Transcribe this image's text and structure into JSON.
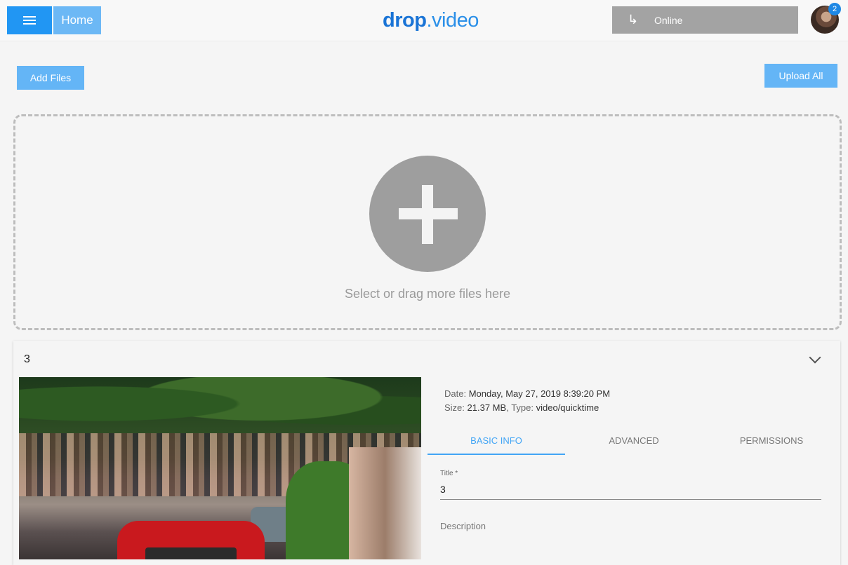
{
  "header": {
    "home_label": "Home",
    "logo_part1": "drop",
    "logo_part2": ".video",
    "status_label": "Online",
    "notification_count": "2"
  },
  "actions": {
    "add_files_label": "Add Files",
    "upload_all_label": "Upload All"
  },
  "dropzone": {
    "prompt": "Select or drag more files here"
  },
  "file": {
    "title": "3",
    "date_label": "Date:",
    "date_value": "Monday, May 27, 2019 8:39:20 PM",
    "size_label": "Size:",
    "size_value": "21.37 MB",
    "type_label": "Type:",
    "type_value": "video/quicktime",
    "tabs": [
      {
        "label": "BASIC INFO",
        "active": true
      },
      {
        "label": "ADVANCED",
        "active": false
      },
      {
        "label": "PERMISSIONS",
        "active": false
      }
    ],
    "form": {
      "title_label": "Title *",
      "title_value": "3",
      "description_label": "Description"
    }
  },
  "colors": {
    "primary": "#2196f3",
    "primary_light": "#64b5f6",
    "status_bg": "#a3a3a3",
    "tab_active": "#42a5f5"
  }
}
